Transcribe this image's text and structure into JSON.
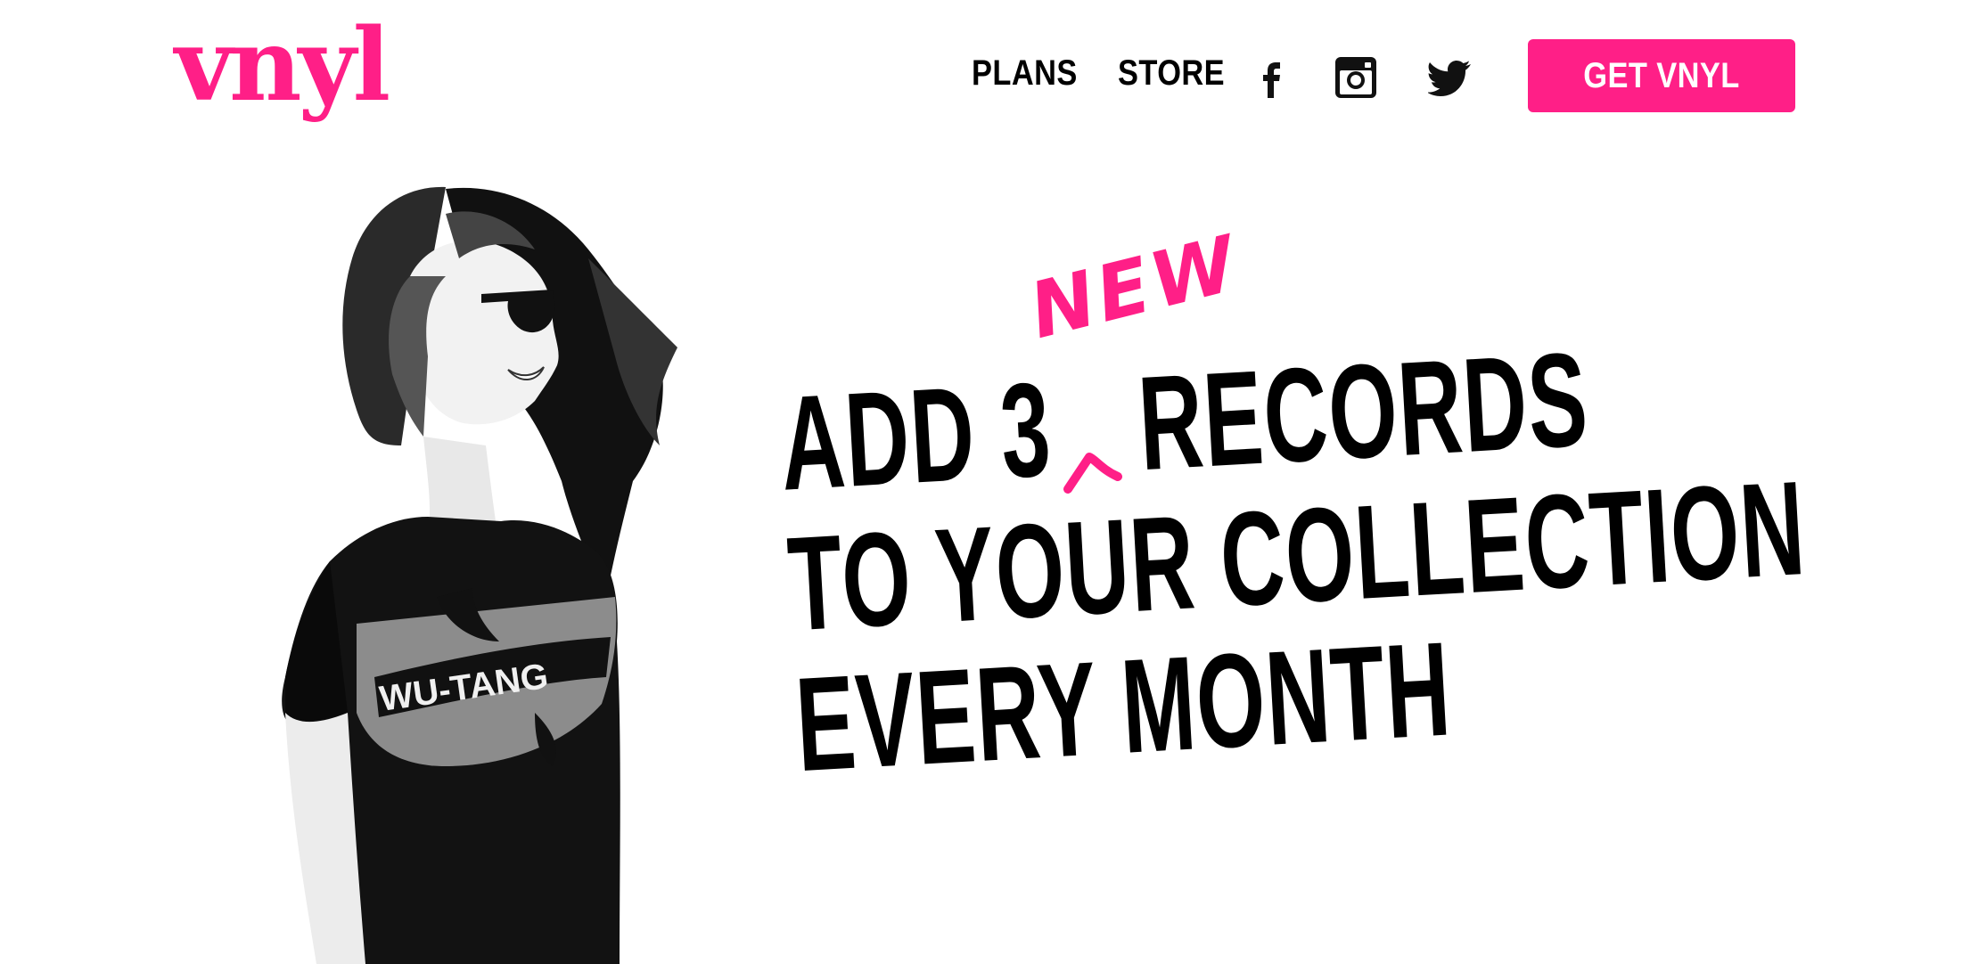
{
  "header": {
    "logo_text": "vnyl",
    "nav": {
      "plans_label": "PLANS",
      "store_label": "STORE"
    },
    "social_icons": [
      "facebook-icon",
      "instagram-icon",
      "twitter-icon"
    ],
    "cta_label": "GET VNYL"
  },
  "hero": {
    "line1_start": "ADD 3",
    "line1_end": "RECORDS",
    "insert_word": "NEW",
    "line2": "TO YOUR COLLECTION",
    "line3": "EVERY MONTH",
    "photo_shirt_text": "WU-TANG"
  },
  "colors": {
    "brand_pink": "#ff1f87",
    "text": "#000000",
    "background": "#ffffff"
  }
}
